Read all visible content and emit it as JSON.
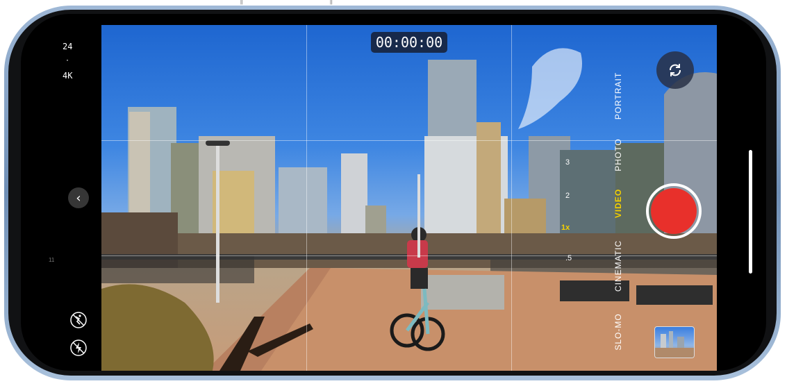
{
  "top_indicators": {
    "left_mark": "||",
    "right_mark": "||"
  },
  "left_bar": {
    "frame_rate": "24",
    "separator": "·",
    "resolution": "4K",
    "back_icon": "chevron-left-icon",
    "notch_mark": "11",
    "action_mode_icon": "action-mode-off-icon",
    "flash_icon": "flash-off-icon"
  },
  "timer": "00:00:00",
  "modes": {
    "portrait": "PORTRAIT",
    "photo": "PHOTO",
    "video": "VIDEO",
    "cinematic": "CINEMATIC",
    "slomo": "SLO-MO"
  },
  "zoom": {
    "z3": "3",
    "z2": "2",
    "z1": "1x",
    "z05": ".5"
  },
  "colors": {
    "accent": "#f5d000",
    "record": "#e8302b"
  },
  "flip_icon": "camera-flip-icon",
  "thumbnail_icon": "last-photo-thumbnail"
}
